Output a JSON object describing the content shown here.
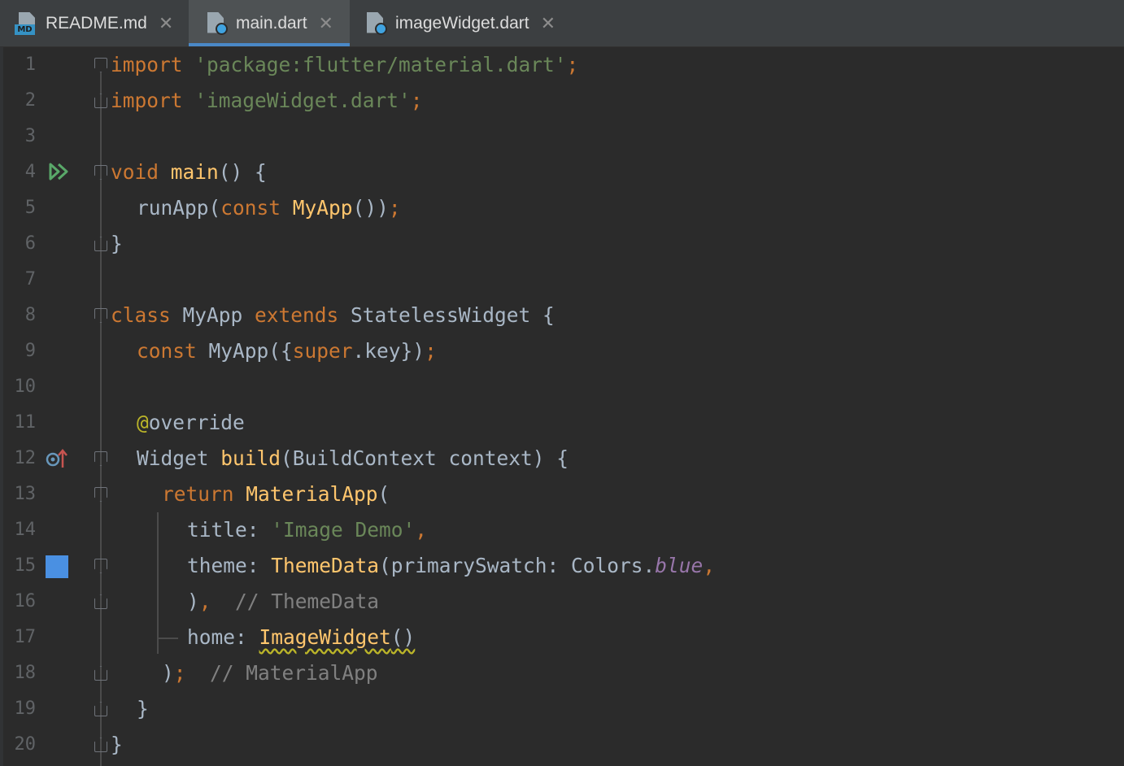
{
  "tabs": [
    {
      "name": "README.md",
      "icon": "markdown-file-icon",
      "active": false
    },
    {
      "name": "main.dart",
      "icon": "dart-file-icon",
      "active": true
    },
    {
      "name": "imageWidget.dart",
      "icon": "dart-file-icon",
      "active": false
    }
  ],
  "md_badge": "MD",
  "close_glyph": "✕",
  "line_numbers": [
    "1",
    "2",
    "3",
    "4",
    "5",
    "6",
    "7",
    "8",
    "9",
    "10",
    "11",
    "12",
    "13",
    "14",
    "15",
    "16",
    "17",
    "18",
    "19",
    "20"
  ],
  "colors": {
    "background": "#2b2b2b",
    "keyword": "#cc7832",
    "string": "#6a8759",
    "function": "#ffc66d",
    "comment": "#808080",
    "annotation": "#bbb529",
    "static_field": "#9876aa",
    "active_tab_underline": "#4a88c7",
    "color_swatch": "#4a90e2",
    "run_icon": "#59a869"
  },
  "gutter_icons": {
    "line_4": "run-icon",
    "line_12": "override-method-icon",
    "line_15": "color-swatch-icon"
  },
  "code": {
    "l1": {
      "kw": "import",
      "sp": " ",
      "str": "'package:flutter/material.dart'",
      "semi": ";"
    },
    "l2": {
      "kw": "import",
      "sp": " ",
      "str": "'imageWidget.dart'",
      "semi": ";"
    },
    "l4": {
      "kw": "void",
      "sp": " ",
      "fn": "main",
      "rest": "() {"
    },
    "l5": {
      "a": "runApp(",
      "kw": "const",
      "sp": " ",
      "fn": "MyApp",
      "b": "())",
      "semi": ";"
    },
    "l6": {
      "a": "}"
    },
    "l8": {
      "kw1": "class",
      "a": " MyApp ",
      "kw2": "extends",
      "b": " StatelessWidget {"
    },
    "l9": {
      "kw": "const",
      "a": " MyApp({",
      "kw2": "super",
      "b": ".key})",
      "semi": ";"
    },
    "l11": {
      "ann": "@",
      "a": "override"
    },
    "l12": {
      "a": "Widget ",
      "fn": "build",
      "b": "(BuildContext context) {"
    },
    "l13": {
      "kw": "return",
      "sp": " ",
      "fn": "MaterialApp",
      "a": "("
    },
    "l14": {
      "a": "title: ",
      "str": "'Image Demo'",
      "comma": ","
    },
    "l15": {
      "a": "theme: ",
      "fn": "ThemeData",
      "b": "(primarySwatch: Colors.",
      "it": "blue",
      "comma": ","
    },
    "l16": {
      "a": ")",
      "comma": ",",
      "cmt": "  // ThemeData"
    },
    "l17": {
      "a": "home: ",
      "fn": "ImageWidget",
      "b": "()"
    },
    "l18": {
      "a": ")",
      "semi": ";",
      "cmt": "  // MaterialApp"
    },
    "l19": {
      "a": "}"
    },
    "l20": {
      "a": "}"
    }
  }
}
